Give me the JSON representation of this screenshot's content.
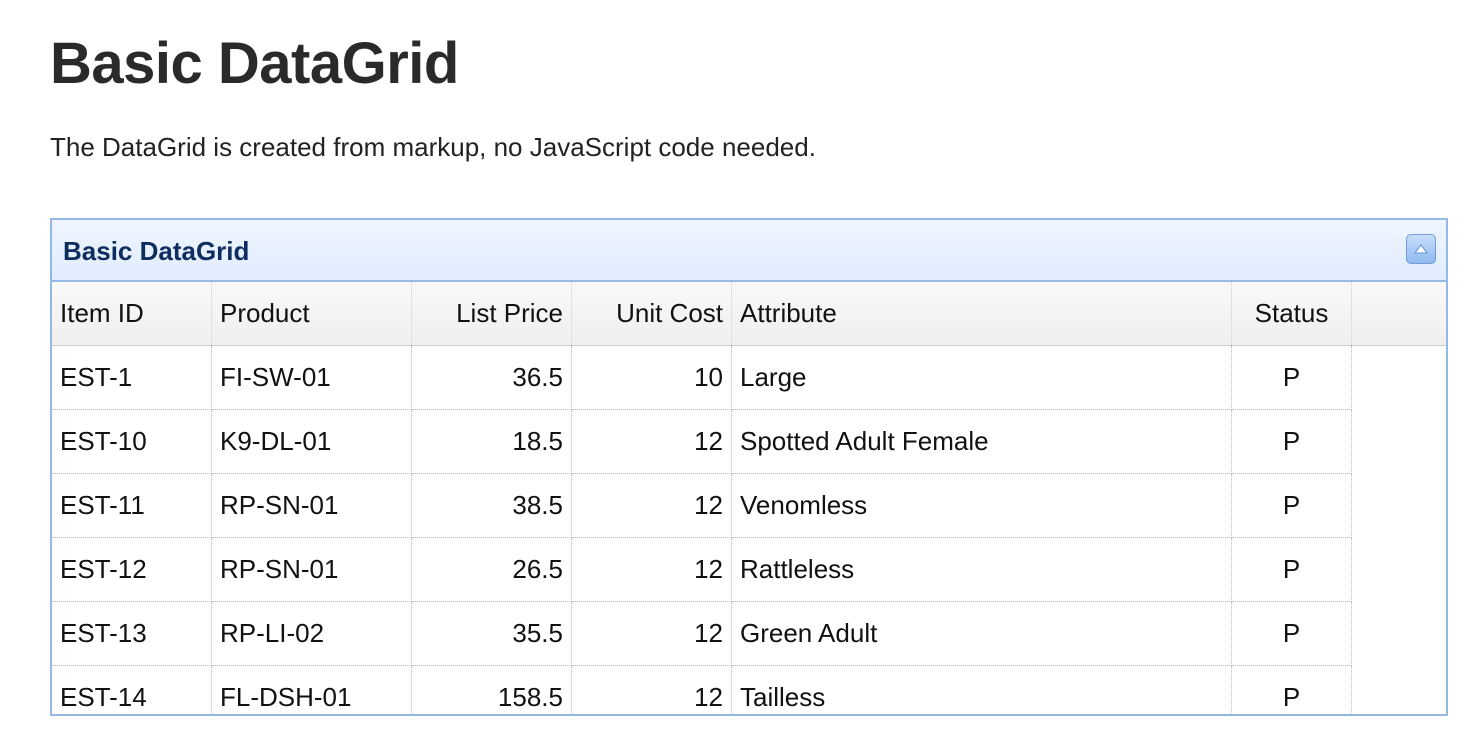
{
  "page": {
    "title": "Basic DataGrid",
    "description": "The DataGrid is created from markup, no JavaScript code needed."
  },
  "panel": {
    "title": "Basic DataGrid",
    "collapse_icon": "chevron-up-icon",
    "header_color": "#e0ecff",
    "border_color": "#95b8e7"
  },
  "grid": {
    "columns": [
      "Item ID",
      "Product",
      "List Price",
      "Unit Cost",
      "Attribute",
      "Status"
    ],
    "rows": [
      [
        "EST-1",
        "FI-SW-01",
        "36.5",
        "10",
        "Large",
        "P"
      ],
      [
        "EST-10",
        "K9-DL-01",
        "18.5",
        "12",
        "Spotted Adult Female",
        "P"
      ],
      [
        "EST-11",
        "RP-SN-01",
        "38.5",
        "12",
        "Venomless",
        "P"
      ],
      [
        "EST-12",
        "RP-SN-01",
        "26.5",
        "12",
        "Rattleless",
        "P"
      ],
      [
        "EST-13",
        "RP-LI-02",
        "35.5",
        "12",
        "Green Adult",
        "P"
      ],
      [
        "EST-14",
        "FL-DSH-01",
        "158.5",
        "12",
        "Tailless",
        "P"
      ]
    ]
  }
}
